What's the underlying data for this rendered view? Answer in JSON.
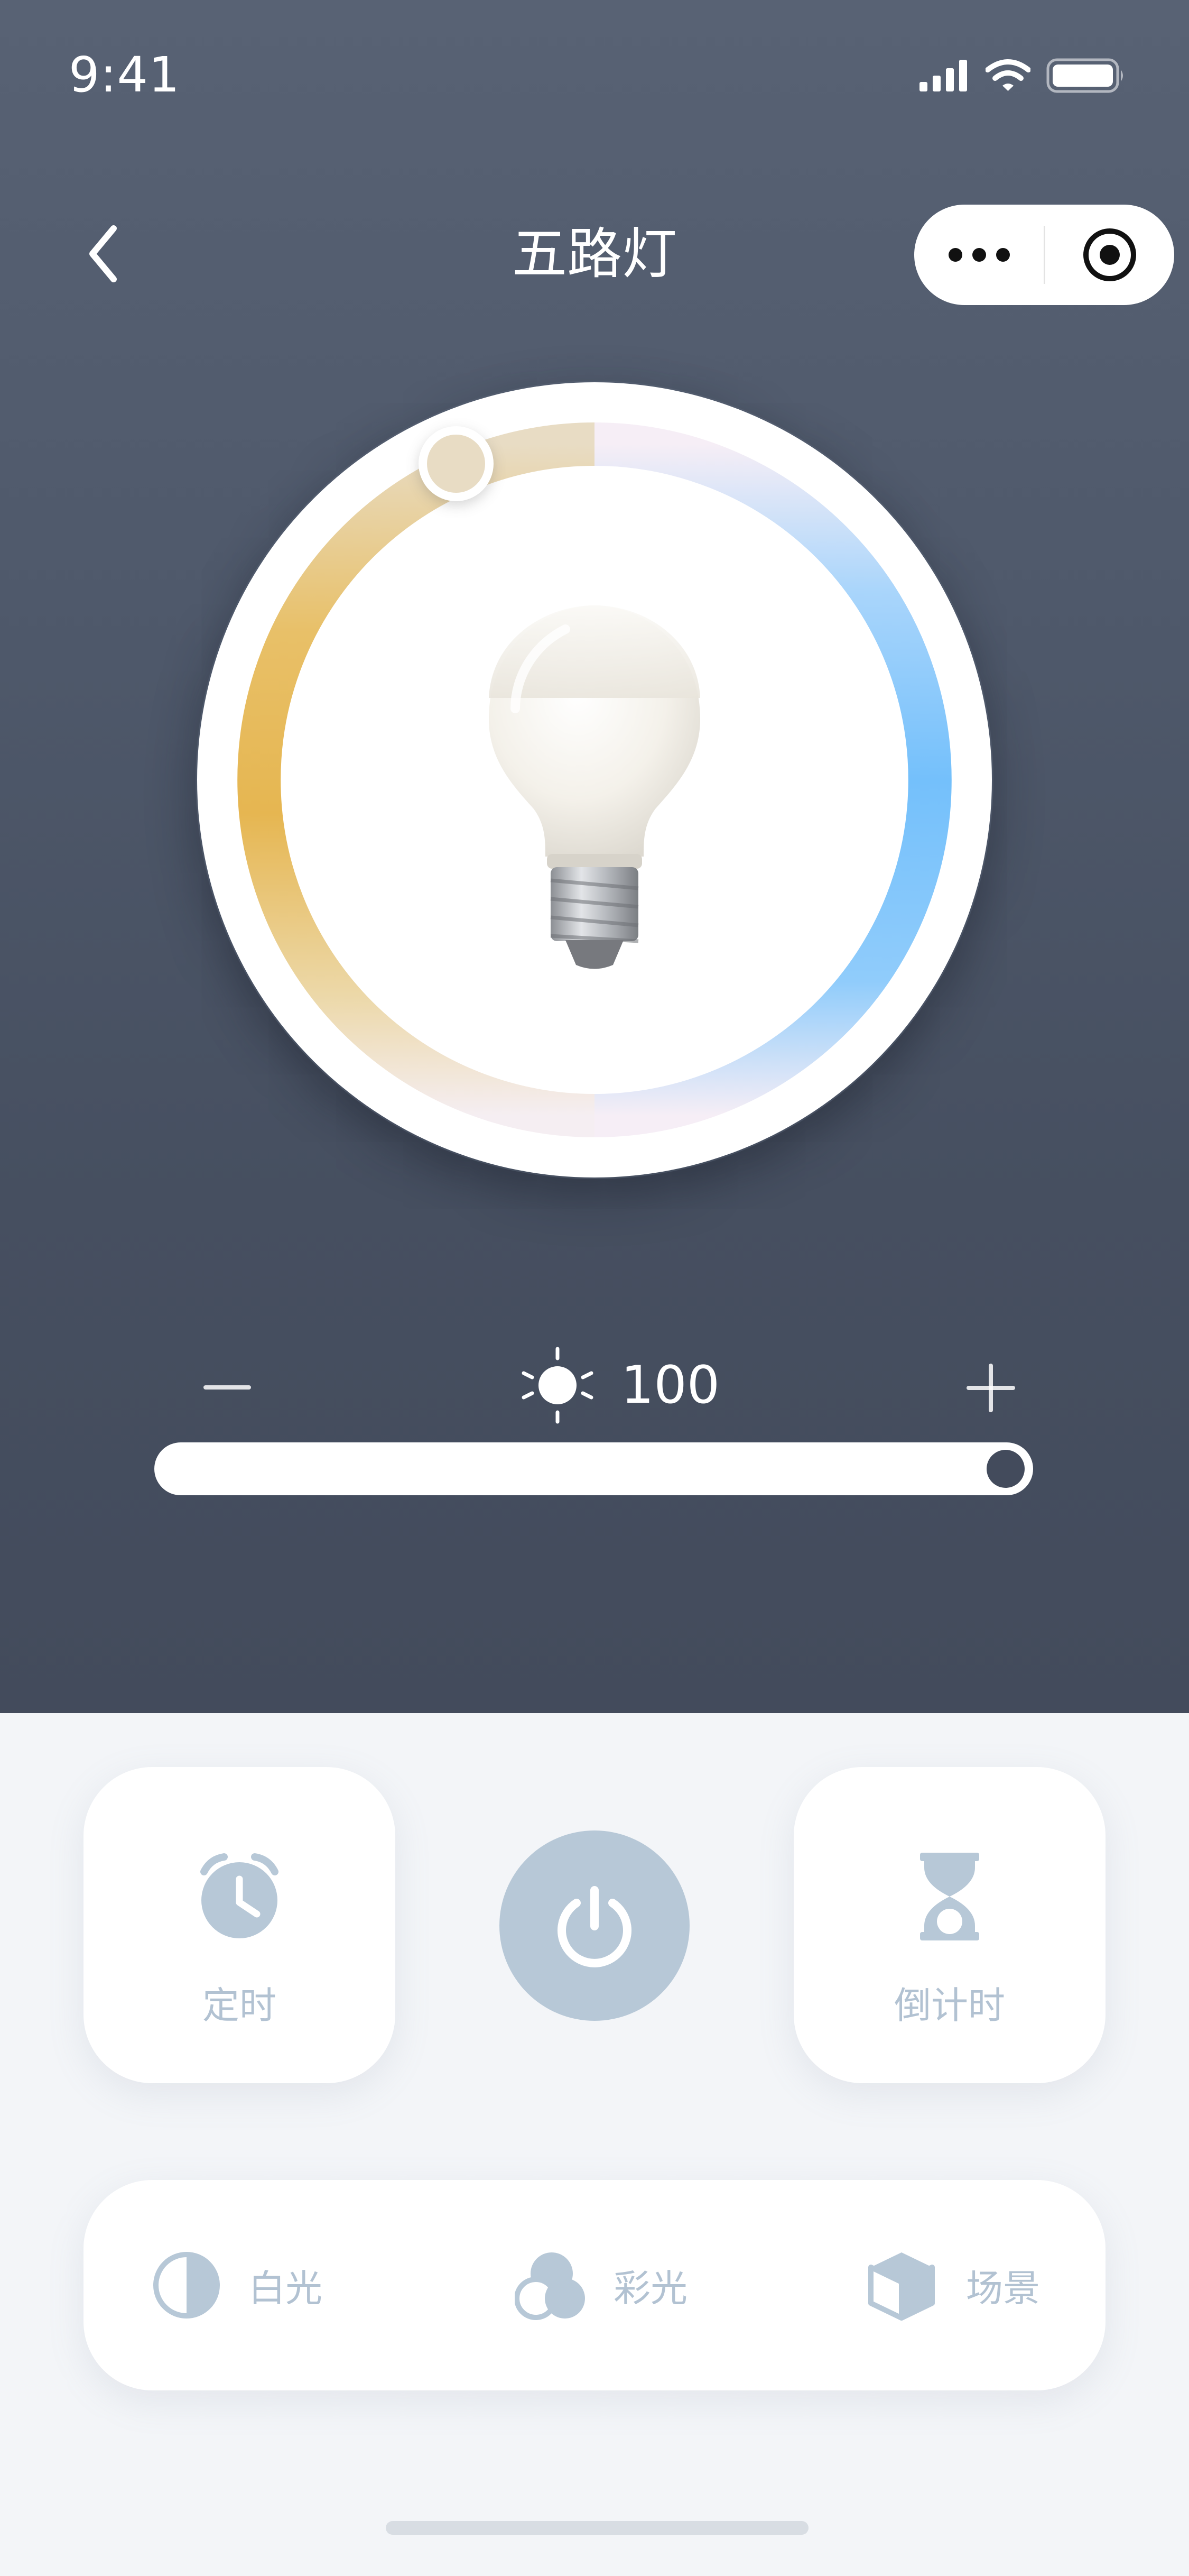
{
  "status_bar": {
    "time": "9:41",
    "icons": [
      "signal-icon",
      "wifi-icon",
      "battery-icon"
    ]
  },
  "nav": {
    "title": "五路灯",
    "back_icon": "chevron-left-icon",
    "more_icon": "more-icon",
    "close_icon": "target-icon"
  },
  "dial": {
    "warm_color": "#e6b651",
    "neutral_color": "#f6eef6",
    "cool_color": "#74c0fb",
    "knob_color": "#e8dcc4"
  },
  "brightness": {
    "value": "100",
    "level": 1.0,
    "minus_icon": "minus-icon",
    "plus_icon": "plus-icon",
    "sun_icon": "sun-icon"
  },
  "actions": {
    "timer_label": "定时",
    "countdown_label": "倒计时",
    "power_icon": "power-icon"
  },
  "modes": [
    {
      "label": "白光",
      "icon": "half-circle-icon"
    },
    {
      "label": "彩光",
      "icon": "color-circles-icon"
    },
    {
      "label": "场景",
      "icon": "cube-icon"
    }
  ],
  "colors": {
    "header_bg": "#4b5466",
    "icon_muted": "#b7c8d7",
    "label_muted": "#b2c2d2"
  }
}
